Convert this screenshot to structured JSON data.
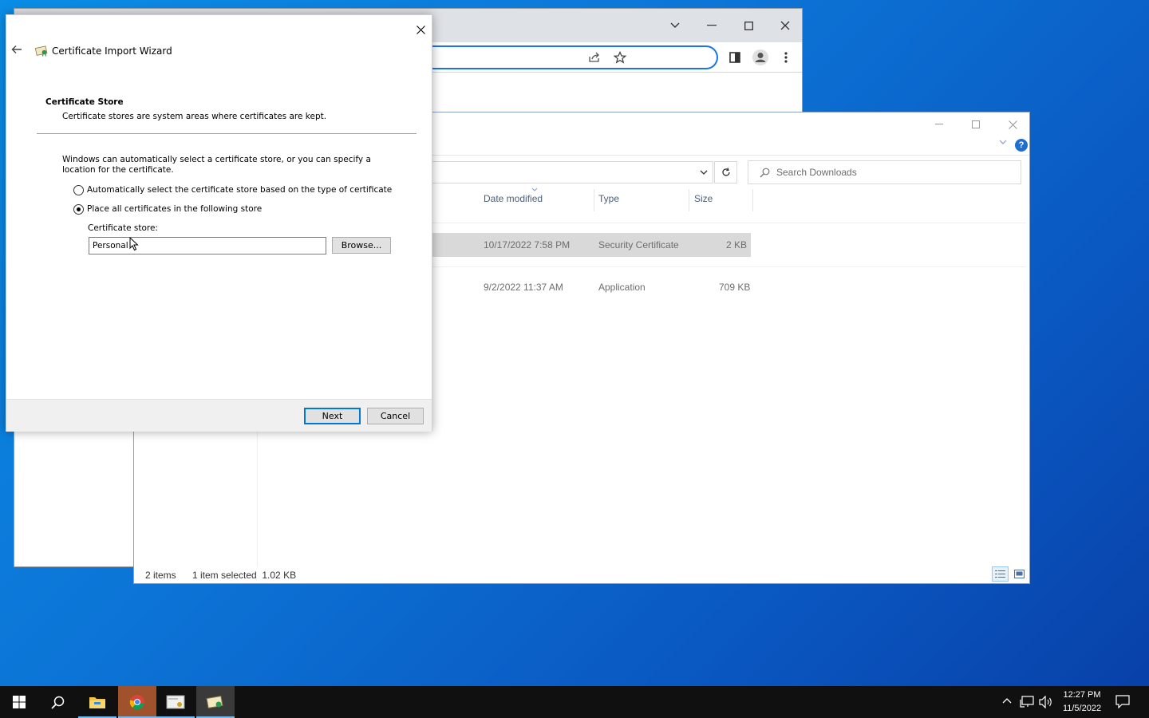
{
  "wizard": {
    "title": "Certificate Import Wizard",
    "section_title": "Certificate Store",
    "section_desc": "Certificate stores are system areas where certificates are kept.",
    "intro": "Windows can automatically select a certificate store, or you can specify a location for the certificate.",
    "radio_auto_label": "Automatically select the certificate store based on the type of certificate",
    "radio_auto_checked": false,
    "radio_manual_label": "Place all certificates in the following store",
    "radio_manual_checked": true,
    "store_label": "Certificate store:",
    "store_value": "Personal",
    "browse_label": "Browse...",
    "next_label": "Next",
    "cancel_label": "Cancel"
  },
  "explorer": {
    "search_placeholder": "Search Downloads",
    "columns": {
      "date_modified": "Date modified",
      "type": "Type",
      "size": "Size"
    },
    "rows": [
      {
        "date": "10/17/2022 7:58 PM",
        "type": "Security Certificate",
        "size": "2 KB",
        "selected": true
      },
      {
        "date": "9/2/2022 11:37 AM",
        "type": "Application",
        "size": "709 KB",
        "selected": false
      }
    ],
    "status": {
      "items": "2 items",
      "selection": "1 item selected  1.02 KB"
    }
  },
  "taskbar": {
    "time": "12:27 PM",
    "date": "11/5/2022"
  },
  "colors": {
    "accent": "#0078d7",
    "omnibox_focus": "#1a73e8",
    "taskbar": "#101010"
  }
}
